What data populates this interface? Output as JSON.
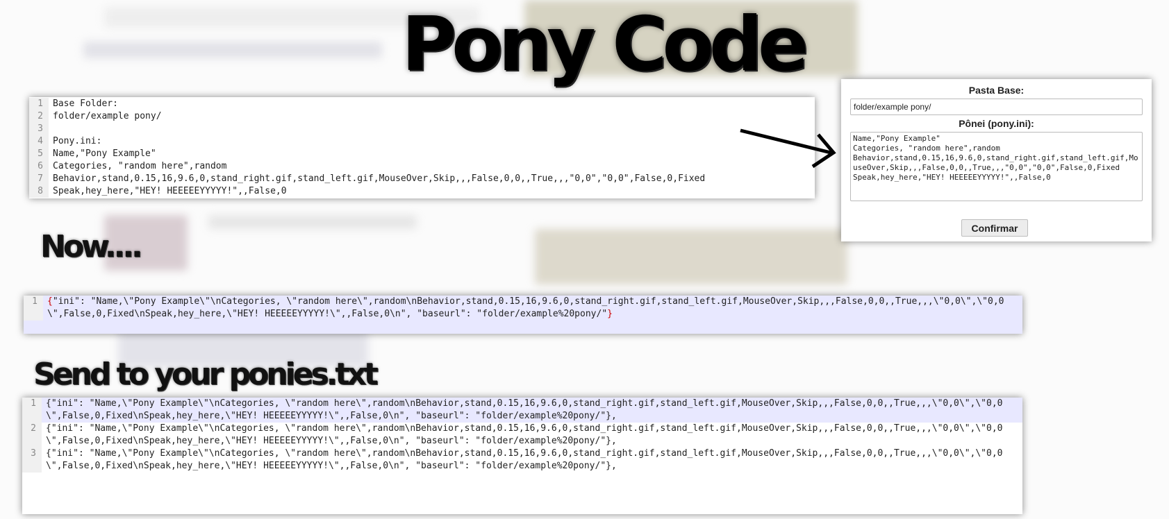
{
  "title": "Pony Code",
  "headings": {
    "now": "Now....",
    "send": "Send to your ponies.txt"
  },
  "source_code": {
    "lines": [
      {
        "num": "1",
        "text": "Base Folder:"
      },
      {
        "num": "2",
        "text": "folder/example pony/"
      },
      {
        "num": "3",
        "text": ""
      },
      {
        "num": "4",
        "text": "Pony.ini:"
      },
      {
        "num": "5",
        "text": "Name,\"Pony Example\""
      },
      {
        "num": "6",
        "text": "Categories, \"random here\",random"
      },
      {
        "num": "7",
        "text": "Behavior,stand,0.15,16,9.6,0,stand_right.gif,stand_left.gif,MouseOver,Skip,,,False,0,0,,True,,,\"0,0\",\"0,0\",False,0,Fixed"
      },
      {
        "num": "8",
        "text": "Speak,hey_here,\"HEY! HEEEEEYYYYY!\",,False,0"
      }
    ]
  },
  "form": {
    "base_label": "Pasta Base:",
    "base_value": "folder/example pony/",
    "ini_label": "Pônei (pony.ini):",
    "ini_value": "Name,\"Pony Example\"\nCategories, \"random here\",random\nBehavior,stand,0.15,16,9.6,0,stand_right.gif,stand_left.gif,MouseOver,Skip,,,False,0,0,,True,,,\"0,0\",\"0,0\",False,0,Fixed\nSpeak,hey_here,\"HEY! HEEEEEYYYYY!\",,False,0",
    "confirm_label": "Confirmar"
  },
  "json_output": {
    "line_number": "1",
    "brace_open": "{",
    "body": "\"ini\": \"Name,\\\"Pony Example\\\"\\nCategories, \\\"random here\\\",random\\nBehavior,stand,0.15,16,9.6,0,stand_right.gif,stand_left.gif,MouseOver,Skip,,,False,0,0,,True,,,\\\"0,0\\\",\\\"0,0\\\",False,0,Fixed\\nSpeak,hey_here,\\\"HEY! HEEEEEYYYYY!\\\",,False,0\\n\", \"baseurl\": \"folder/example%20pony/\"",
    "brace_close": "}"
  },
  "ponies_txt": {
    "lines": [
      {
        "num": "1",
        "text": "{\"ini\": \"Name,\\\"Pony Example\\\"\\nCategories, \\\"random here\\\",random\\nBehavior,stand,0.15,16,9.6,0,stand_right.gif,stand_left.gif,MouseOver,Skip,,,False,0,0,,True,,,\\\"0,0\\\",\\\"0,0\\\",False,0,Fixed\\nSpeak,hey_here,\\\"HEY! HEEEEEYYYYY!\\\",,False,0\\n\", \"baseurl\": \"folder/example%20pony/\"},"
      },
      {
        "num": "2",
        "text": "{\"ini\": \"Name,\\\"Pony Example\\\"\\nCategories, \\\"random here\\\",random\\nBehavior,stand,0.15,16,9.6,0,stand_right.gif,stand_left.gif,MouseOver,Skip,,,False,0,0,,True,,,\\\"0,0\\\",\\\"0,0\\\",False,0,Fixed\\nSpeak,hey_here,\\\"HEY! HEEEEEYYYYY!\\\",,False,0\\n\", \"baseurl\": \"folder/example%20pony/\"},"
      },
      {
        "num": "3",
        "text": "{\"ini\": \"Name,\\\"Pony Example\\\"\\nCategories, \\\"random here\\\",random\\nBehavior,stand,0.15,16,9.6,0,stand_right.gif,stand_left.gif,MouseOver,Skip,,,False,0,0,,True,,,\\\"0,0\\\",\\\"0,0\\\",False,0,Fixed\\nSpeak,hey_here,\\\"HEY! HEEEEEYYYYY!\\\",,False,0\\n\", \"baseurl\": \"folder/example%20pony/\"},"
      }
    ]
  },
  "colors": {
    "brace": "#cc0000",
    "highlight_row": "#e8e8ff",
    "gutter": "#f0f0f0"
  },
  "icons": {
    "arrow": "arrow-icon"
  }
}
